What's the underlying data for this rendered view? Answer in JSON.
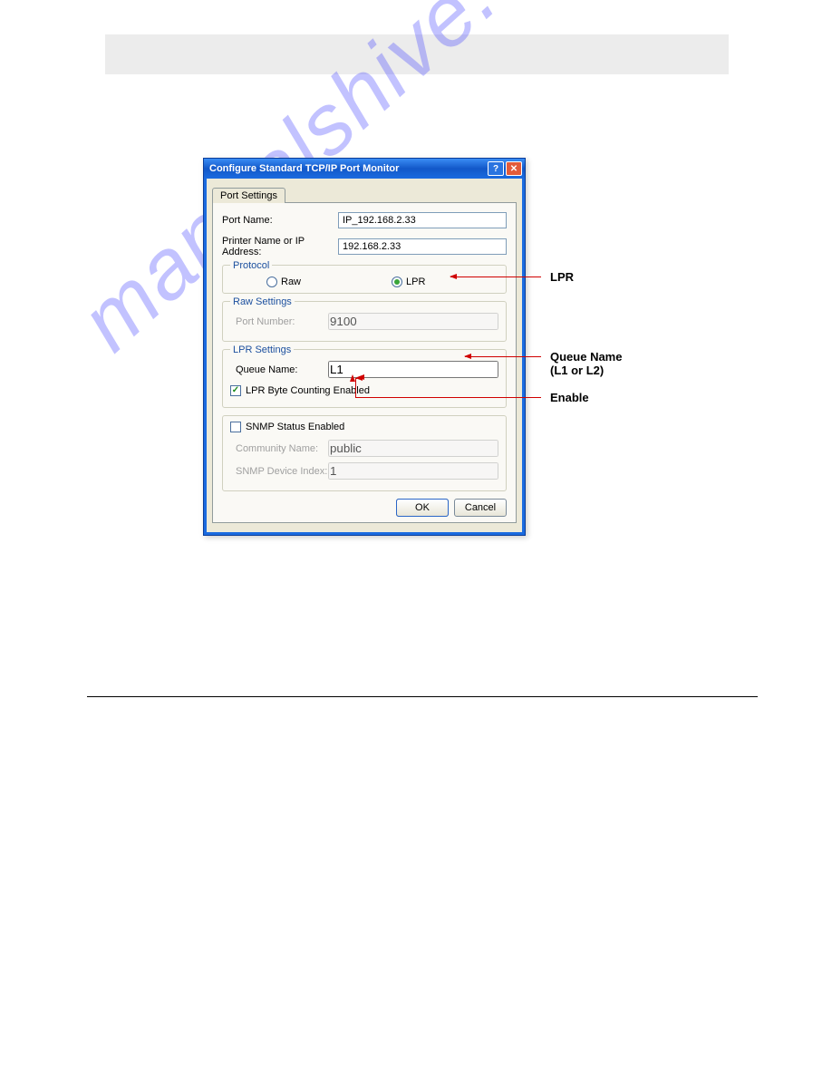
{
  "dialog": {
    "title": "Configure Standard TCP/IP Port Monitor",
    "tab_label": "Port Settings",
    "port_name_label": "Port Name:",
    "port_name_value": "IP_192.168.2.33",
    "printer_label": "Printer Name or IP Address:",
    "printer_value": "192.168.2.33",
    "protocol_legend": "Protocol",
    "protocol_raw": "Raw",
    "protocol_lpr": "LPR",
    "raw_legend": "Raw Settings",
    "raw_port_label": "Port Number:",
    "raw_port_value": "9100",
    "lpr_legend": "LPR Settings",
    "queue_label": "Queue Name:",
    "queue_value": "L1",
    "lpr_bytecount_label": "LPR Byte Counting Enabled",
    "snmp_enabled_label": "SNMP Status Enabled",
    "community_label": "Community Name:",
    "community_value": "public",
    "snmp_index_label": "SNMP Device Index:",
    "snmp_index_value": "1",
    "ok_label": "OK",
    "cancel_label": "Cancel"
  },
  "callouts": {
    "lpr": "LPR",
    "queue": "Queue Name",
    "queue_sub": "(L1 or L2)",
    "enable": "Enable"
  },
  "watermark": "manualshive.com"
}
